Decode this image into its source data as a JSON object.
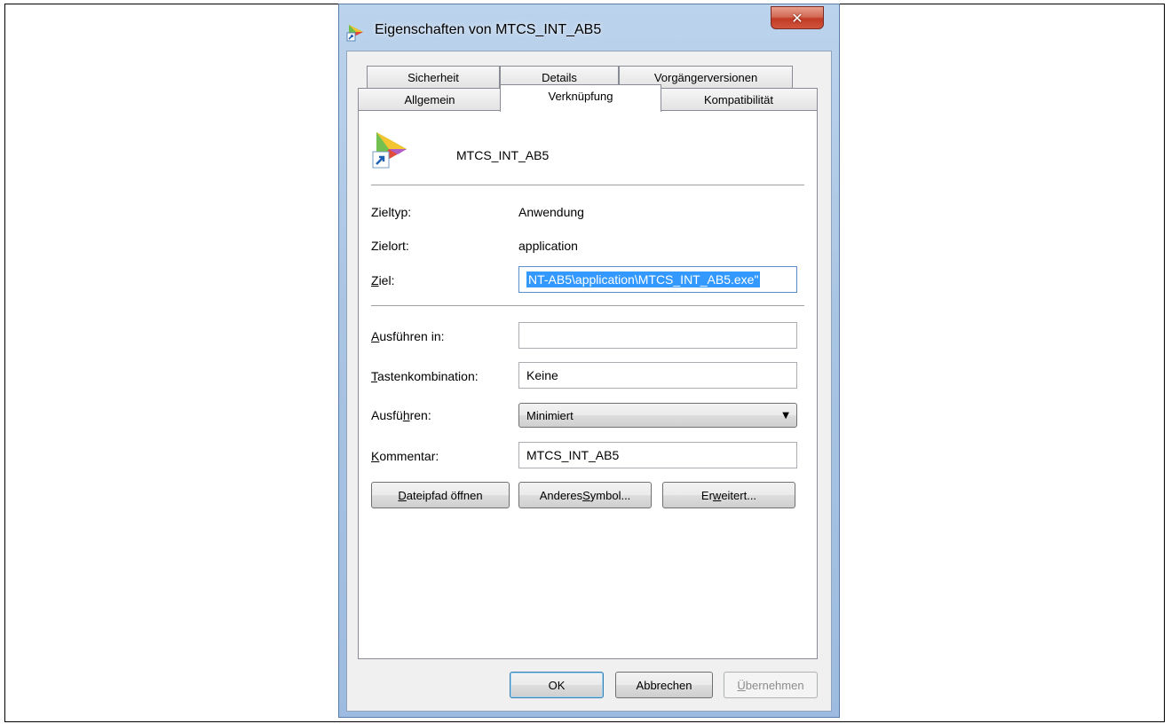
{
  "window": {
    "title": "Eigenschaften von MTCS_INT_AB5",
    "close_glyph": "✕"
  },
  "tabs": {
    "row_top": [
      {
        "label": "Sicherheit"
      },
      {
        "label": "Details"
      },
      {
        "label": "Vorgängerversionen"
      }
    ],
    "row_bottom": [
      {
        "label": "Allgemein"
      },
      {
        "label": "Verknüpfung",
        "active": true
      },
      {
        "label": "Kompatibilität"
      }
    ]
  },
  "shortcut": {
    "name": "MTCS_INT_AB5",
    "icon": "application-shortcut-icon"
  },
  "fields": {
    "zieltyp": {
      "label": "Zieltyp:",
      "value": "Anwendung"
    },
    "zielort": {
      "label": "Zielort:",
      "value": "application"
    },
    "ziel": {
      "label_pre": "",
      "label_ul": "Z",
      "label_post": "iel:",
      "value": "NT-AB5\\application\\MTCS_INT_AB5.exe\""
    },
    "ausfuehren_in": {
      "label_pre": "",
      "label_ul": "A",
      "label_post": "usführen in:",
      "value": ""
    },
    "tastenkombination": {
      "label_pre": "",
      "label_ul": "T",
      "label_post": "astenkombination:",
      "value": "Keine"
    },
    "ausfuehren": {
      "label_pre": "Ausfü",
      "label_ul": "h",
      "label_post": "ren:",
      "value": "Minimiert"
    },
    "kommentar": {
      "label_pre": "",
      "label_ul": "K",
      "label_post": "ommentar:",
      "value": "MTCS_INT_AB5"
    }
  },
  "action_buttons": {
    "open_path": {
      "pre": "",
      "ul": "D",
      "post": "ateipfad öffnen"
    },
    "change_icon": {
      "pre": "Anderes ",
      "ul": "S",
      "post": "ymbol..."
    },
    "advanced": {
      "pre": "Er",
      "ul": "w",
      "post": "eitert..."
    }
  },
  "dialog_buttons": {
    "ok": "OK",
    "cancel": "Abbrechen",
    "apply": {
      "pre": "",
      "ul": "Ü",
      "post": "bernehmen",
      "disabled": true
    }
  },
  "colors": {
    "selection": "#3399ff",
    "window_frame": "#a9c4e3",
    "close_button": "#c13b25"
  }
}
